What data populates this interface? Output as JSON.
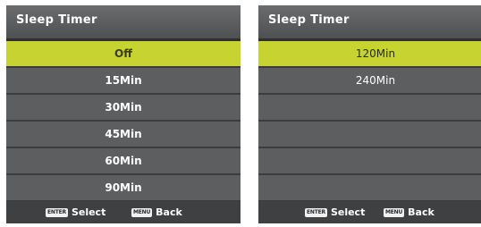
{
  "left_panel": {
    "title": "Sleep Timer",
    "items": [
      {
        "label": "Off",
        "selected": true
      },
      {
        "label": "15Min",
        "selected": false
      },
      {
        "label": "30Min",
        "selected": false
      },
      {
        "label": "45Min",
        "selected": false
      },
      {
        "label": "60Min",
        "selected": false
      },
      {
        "label": "90Min",
        "selected": false
      }
    ],
    "footer": {
      "enter_key": "ENTER",
      "select_label": "Select",
      "menu_key": "MENU",
      "back_label": "Back"
    }
  },
  "right_panel": {
    "title": "Sleep Timer",
    "items": [
      {
        "label": "120Min",
        "selected": true
      },
      {
        "label": "240Min",
        "selected": false
      },
      {
        "label": "",
        "selected": false
      },
      {
        "label": "",
        "selected": false
      },
      {
        "label": "",
        "selected": false
      },
      {
        "label": "",
        "selected": false
      }
    ],
    "footer": {
      "enter_key": "ENTER",
      "select_label": "Select",
      "menu_key": "MENU",
      "back_label": "Back"
    }
  },
  "colors": {
    "highlight": "#c6d330",
    "panel_bg": "#5c5e60",
    "footer_bg": "#3e4042"
  }
}
